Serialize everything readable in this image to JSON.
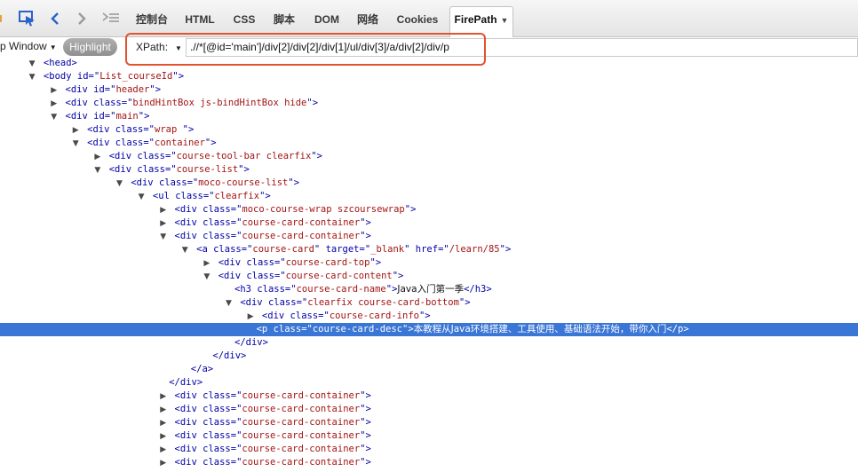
{
  "toolbar": {
    "icons": [
      "bug-icon",
      "inspect-icon",
      "back-icon",
      "forward-icon",
      "command-line-icon"
    ],
    "tabs": [
      {
        "label": "控制台"
      },
      {
        "label": "HTML"
      },
      {
        "label": "CSS"
      },
      {
        "label": "脚本"
      },
      {
        "label": "DOM"
      },
      {
        "label": "网络"
      },
      {
        "label": "Cookies"
      },
      {
        "label": "FirePath"
      }
    ]
  },
  "firepath": {
    "top_window_label": "p Window",
    "highlight_label": "Highlight",
    "xpath_label": "XPath:",
    "xpath_value": ".//*[@id='main']/div[2]/div[2]/div[1]/ul/div[3]/a/div[2]/div/p"
  },
  "colors": {
    "selection": "#3a76d6",
    "annotation_frame": "#e2532f",
    "tag": "#0000a8",
    "attr_value": "#a31515"
  },
  "tree": [
    {
      "indent": 1,
      "toggle": "open",
      "tag": "head",
      "attrs": [],
      "trunc": true
    },
    {
      "indent": 1,
      "toggle": "open",
      "tag": "body",
      "attrs": [
        {
          "n": "id",
          "v": "List_courseId"
        }
      ]
    },
    {
      "indent": 2,
      "toggle": "closed",
      "tag": "div",
      "attrs": [
        {
          "n": "id",
          "v": "header"
        }
      ]
    },
    {
      "indent": 2,
      "toggle": "closed",
      "tag": "div",
      "attrs": [
        {
          "n": "class",
          "v": "bindHintBox js-bindHintBox hide"
        }
      ]
    },
    {
      "indent": 2,
      "toggle": "open",
      "tag": "div",
      "attrs": [
        {
          "n": "id",
          "v": "main"
        }
      ]
    },
    {
      "indent": 3,
      "toggle": "closed",
      "tag": "div",
      "attrs": [
        {
          "n": "class",
          "v": "wrap "
        }
      ]
    },
    {
      "indent": 3,
      "toggle": "open",
      "tag": "div",
      "attrs": [
        {
          "n": "class",
          "v": "container"
        }
      ]
    },
    {
      "indent": 4,
      "toggle": "closed",
      "tag": "div",
      "attrs": [
        {
          "n": "class",
          "v": "course-tool-bar clearfix"
        }
      ]
    },
    {
      "indent": 4,
      "toggle": "open",
      "tag": "div",
      "attrs": [
        {
          "n": "class",
          "v": "course-list"
        }
      ]
    },
    {
      "indent": 5,
      "toggle": "open",
      "tag": "div",
      "attrs": [
        {
          "n": "class",
          "v": "moco-course-list"
        }
      ]
    },
    {
      "indent": 6,
      "toggle": "open",
      "tag": "ul",
      "attrs": [
        {
          "n": "class",
          "v": "clearfix"
        }
      ]
    },
    {
      "indent": 7,
      "toggle": "closed",
      "tag": "div",
      "attrs": [
        {
          "n": "class",
          "v": "moco-course-wrap szcoursewrap"
        }
      ]
    },
    {
      "indent": 7,
      "toggle": "closed",
      "tag": "div",
      "attrs": [
        {
          "n": "class",
          "v": "course-card-container"
        }
      ]
    },
    {
      "indent": 7,
      "toggle": "open",
      "tag": "div",
      "attrs": [
        {
          "n": "class",
          "v": "course-card-container"
        }
      ]
    },
    {
      "indent": 8,
      "toggle": "open",
      "tag": "a",
      "attrs": [
        {
          "n": "class",
          "v": "course-card"
        },
        {
          "n": "target",
          "v": "_blank"
        },
        {
          "n": "href",
          "v": "/learn/85"
        }
      ]
    },
    {
      "indent": 9,
      "toggle": "closed",
      "tag": "div",
      "attrs": [
        {
          "n": "class",
          "v": "course-card-top"
        }
      ]
    },
    {
      "indent": 9,
      "toggle": "open",
      "tag": "div",
      "attrs": [
        {
          "n": "class",
          "v": "course-card-content"
        }
      ]
    },
    {
      "indent": 10,
      "toggle": "none",
      "tag": "h3",
      "attrs": [
        {
          "n": "class",
          "v": "course-card-name"
        }
      ],
      "text": "Java入门第一季",
      "close": "h3"
    },
    {
      "indent": 10,
      "toggle": "open",
      "tag": "div",
      "attrs": [
        {
          "n": "class",
          "v": "clearfix course-card-bottom"
        }
      ]
    },
    {
      "indent": 11,
      "toggle": "closed",
      "tag": "div",
      "attrs": [
        {
          "n": "class",
          "v": "course-card-info"
        }
      ]
    },
    {
      "indent": 11,
      "toggle": "none",
      "tag": "p",
      "attrs": [
        {
          "n": "class",
          "v": "course-card-desc"
        }
      ],
      "text": "本教程从Java环境搭建、工具使用、基础语法开始，带你入门",
      "close": "p",
      "selected": true
    },
    {
      "indent": 10,
      "toggle": "none",
      "end": "div"
    },
    {
      "indent": 9,
      "toggle": "none",
      "end": "div"
    },
    {
      "indent": 8,
      "toggle": "none",
      "end": "a"
    },
    {
      "indent": 7,
      "toggle": "none",
      "end": "div"
    },
    {
      "indent": 7,
      "toggle": "closed",
      "tag": "div",
      "attrs": [
        {
          "n": "class",
          "v": "course-card-container"
        }
      ]
    },
    {
      "indent": 7,
      "toggle": "closed",
      "tag": "div",
      "attrs": [
        {
          "n": "class",
          "v": "course-card-container"
        }
      ]
    },
    {
      "indent": 7,
      "toggle": "closed",
      "tag": "div",
      "attrs": [
        {
          "n": "class",
          "v": "course-card-container"
        }
      ]
    },
    {
      "indent": 7,
      "toggle": "closed",
      "tag": "div",
      "attrs": [
        {
          "n": "class",
          "v": "course-card-container"
        }
      ]
    },
    {
      "indent": 7,
      "toggle": "closed",
      "tag": "div",
      "attrs": [
        {
          "n": "class",
          "v": "course-card-container"
        }
      ]
    },
    {
      "indent": 7,
      "toggle": "closed",
      "tag": "div",
      "attrs": [
        {
          "n": "class",
          "v": "course-card-container"
        }
      ]
    }
  ]
}
